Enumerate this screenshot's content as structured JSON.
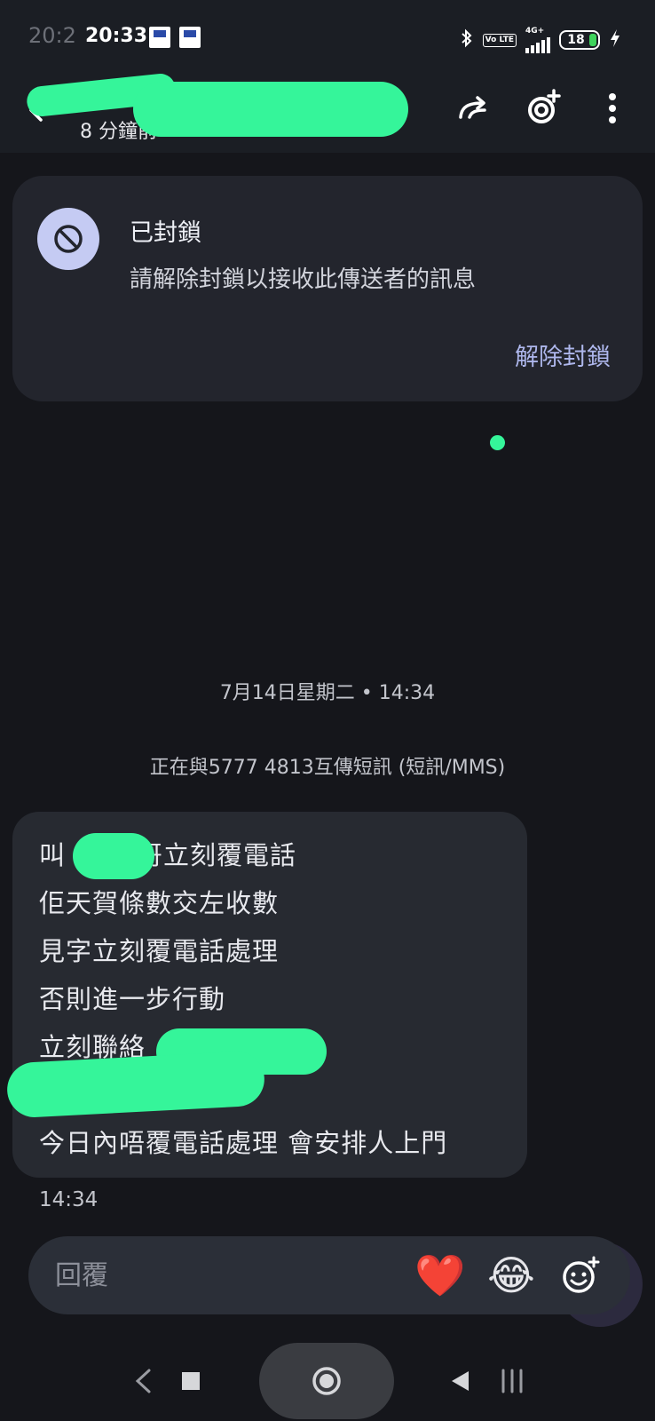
{
  "status_bar": {
    "ghost_time": "20:2",
    "time": "20:33",
    "network_label": "4G+",
    "volte_label": "Vo LTE",
    "battery_level": "18",
    "battery_color": "#3fd45c"
  },
  "app_bar": {
    "subtitle": "8 分鐘前",
    "icons": [
      "back-arrow-icon",
      "forward-icon",
      "add-reaction-icon",
      "more-vert-icon"
    ]
  },
  "blocked_card": {
    "title": "已封鎖",
    "description": "請解除封鎖以接收此傳送者的訊息",
    "action": "解除封鎖"
  },
  "conversation": {
    "date_separator": "7月14日星期二 • 14:34",
    "sms_info": "正在與5777 4813互傳短訊 (短訊/MMS)",
    "message": {
      "lines": [
        "叫",
        "哥立刻覆電話",
        "佢天賀條數交左收數",
        "見字立刻覆電話處理",
        "否則進一步行動",
        "立刻聯絡",
        "今日內唔覆電話處理 會安排人上門"
      ],
      "time": "14:34"
    }
  },
  "reply_bar": {
    "placeholder": "回覆",
    "quick_reactions": [
      "❤️",
      "😂"
    ]
  },
  "colors": {
    "background": "#15161b",
    "card": "#23252d",
    "accent_link": "#aeb7ec",
    "redaction": "#35f59a"
  }
}
